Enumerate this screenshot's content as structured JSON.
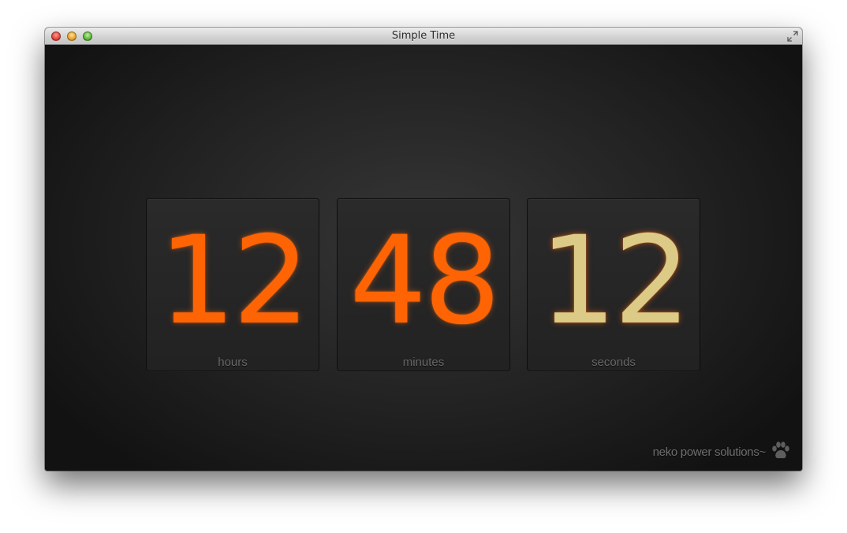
{
  "window": {
    "title": "Simple Time"
  },
  "clock": {
    "hours": {
      "value": "12",
      "label": "hours",
      "color": "#ff6404"
    },
    "minutes": {
      "value": "48",
      "label": "minutes",
      "color": "#ff6404"
    },
    "seconds": {
      "value": "12",
      "label": "seconds",
      "color": "#dccb86"
    }
  },
  "footer": {
    "brand": "neko power solutions~",
    "icon": "paw-icon"
  },
  "colors": {
    "accent": "#ff6404",
    "seconds": "#dccb86",
    "label": "#666666",
    "background": "#232323"
  }
}
